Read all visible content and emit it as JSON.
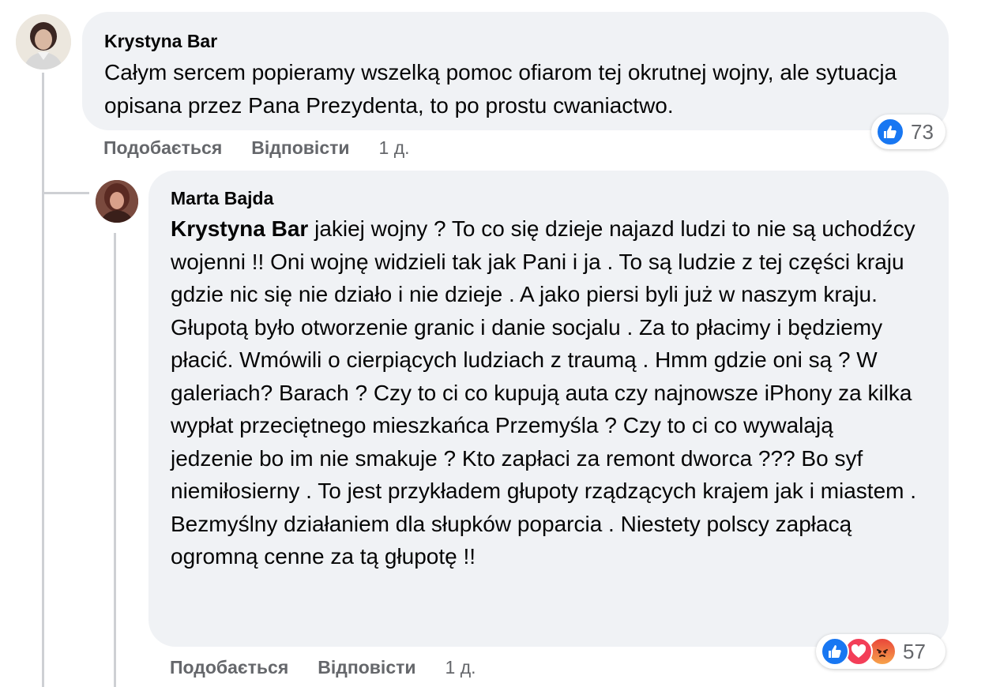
{
  "comments": [
    {
      "author": "Krystyna Bar",
      "text": "Całym sercem popieramy wszelką pomoc ofiarom tej okrutnej wojny, ale sytuacja opisana przez Pana Prezydenta, to po prostu cwaniactwo.",
      "actions": {
        "like": "Подобається",
        "reply": "Відповісти",
        "time": "1 д."
      },
      "reactions": {
        "types": [
          "like"
        ],
        "count": "73"
      }
    },
    {
      "author": "Marta Bajda",
      "mention": "Krystyna Bar",
      "text": " jakiej wojny ? To co się dzieje najazd ludzi to nie są uchodźcy wojenni !! Oni wojnę widzieli tak jak Pani i ja . To są ludzie z tej części kraju gdzie nic się nie działo i nie dzieje . A jako piersi byli już w naszym kraju. Głupotą było otworzenie granic i danie socjalu . Za to płacimy i będziemy płacić. Wmówili o cierpiących ludziach z traumą . Hmm gdzie oni są ? W galeriach? Barach ? Czy to ci co kupują auta czy najnowsze iPhony za kilka wypłat przeciętnego mieszkańca Przemyśla ? Czy to ci co wywalają jedzenie bo im nie smakuje ? Kto zapłaci za remont dworca ??? Bo syf niemiłosierny . To jest przykładem głupoty rządzących krajem jak i miastem . Bezmyślny działaniem dla słupków poparcia . Niestety polscy zapłacą ogromną cenne za tą głupotę !!",
      "actions": {
        "like": "Подобається",
        "reply": "Відповісти",
        "time": "1 д."
      },
      "reactions": {
        "types": [
          "like",
          "love",
          "angry"
        ],
        "count": "57"
      }
    }
  ],
  "colors": {
    "like": "#1877f2",
    "love": "#f33e58",
    "angry": "#f7714a",
    "bubble": "#f0f2f5",
    "meta": "#65676b"
  }
}
